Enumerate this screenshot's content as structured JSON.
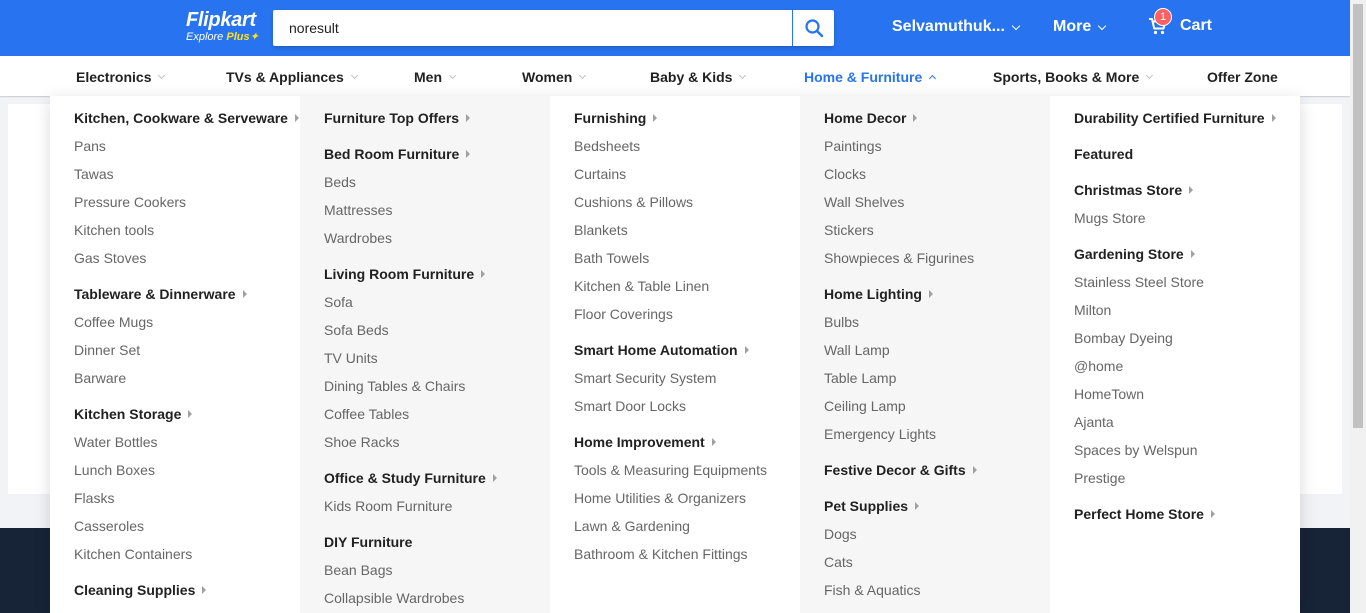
{
  "header": {
    "logo_text": "Flipkart",
    "logo_sub_text": "Explore",
    "logo_plus_text": "Plus",
    "search_value": "noresult",
    "user_name": "Selvamuthuk...",
    "more_label": "More",
    "cart_label": "Cart",
    "cart_count": "1",
    "brand_color": "#2874f0",
    "accent_color": "#ffe11b"
  },
  "categories": [
    {
      "label": "Electronics",
      "active": false
    },
    {
      "label": "TVs & Appliances",
      "active": false
    },
    {
      "label": "Men",
      "active": false
    },
    {
      "label": "Women",
      "active": false
    },
    {
      "label": "Baby & Kids",
      "active": false
    },
    {
      "label": "Home & Furniture",
      "active": true
    },
    {
      "label": "Sports, Books & More",
      "active": false
    },
    {
      "label": "Offer Zone",
      "active": false
    }
  ],
  "menu": {
    "columns": [
      {
        "items": [
          {
            "label": "Kitchen, Cookware & Serveware",
            "type": "head",
            "has_arrow": true
          },
          {
            "label": "Pans",
            "type": "sub"
          },
          {
            "label": "Tawas",
            "type": "sub"
          },
          {
            "label": "Pressure Cookers",
            "type": "sub"
          },
          {
            "label": "Kitchen tools",
            "type": "sub"
          },
          {
            "label": "Gas Stoves",
            "type": "sub"
          },
          {
            "label": "Tableware & Dinnerware",
            "type": "head",
            "has_arrow": true
          },
          {
            "label": "Coffee Mugs",
            "type": "sub"
          },
          {
            "label": "Dinner Set",
            "type": "sub"
          },
          {
            "label": "Barware",
            "type": "sub"
          },
          {
            "label": "Kitchen Storage",
            "type": "head",
            "has_arrow": true
          },
          {
            "label": "Water Bottles",
            "type": "sub"
          },
          {
            "label": "Lunch Boxes",
            "type": "sub"
          },
          {
            "label": "Flasks",
            "type": "sub"
          },
          {
            "label": "Casseroles",
            "type": "sub"
          },
          {
            "label": "Kitchen Containers",
            "type": "sub"
          },
          {
            "label": "Cleaning Supplies",
            "type": "head",
            "has_arrow": true
          }
        ]
      },
      {
        "items": [
          {
            "label": "Furniture Top Offers",
            "type": "head",
            "has_arrow": true
          },
          {
            "label": "Bed Room Furniture",
            "type": "head",
            "has_arrow": true
          },
          {
            "label": "Beds",
            "type": "sub"
          },
          {
            "label": "Mattresses",
            "type": "sub"
          },
          {
            "label": "Wardrobes",
            "type": "sub"
          },
          {
            "label": "Living Room Furniture",
            "type": "head",
            "has_arrow": true
          },
          {
            "label": "Sofa",
            "type": "sub"
          },
          {
            "label": "Sofa Beds",
            "type": "sub"
          },
          {
            "label": "TV Units",
            "type": "sub"
          },
          {
            "label": "Dining Tables & Chairs",
            "type": "sub"
          },
          {
            "label": "Coffee Tables",
            "type": "sub"
          },
          {
            "label": "Shoe Racks",
            "type": "sub"
          },
          {
            "label": "Office & Study Furniture",
            "type": "head",
            "has_arrow": true
          },
          {
            "label": "Kids Room Furniture",
            "type": "sub"
          },
          {
            "label": "DIY Furniture",
            "type": "head",
            "has_arrow": false
          },
          {
            "label": "Bean Bags",
            "type": "sub"
          },
          {
            "label": "Collapsible Wardrobes",
            "type": "sub"
          }
        ]
      },
      {
        "items": [
          {
            "label": "Furnishing",
            "type": "head",
            "has_arrow": true
          },
          {
            "label": "Bedsheets",
            "type": "sub"
          },
          {
            "label": "Curtains",
            "type": "sub"
          },
          {
            "label": "Cushions & Pillows",
            "type": "sub"
          },
          {
            "label": "Blankets",
            "type": "sub"
          },
          {
            "label": "Bath Towels",
            "type": "sub"
          },
          {
            "label": "Kitchen & Table Linen",
            "type": "sub"
          },
          {
            "label": "Floor Coverings",
            "type": "sub"
          },
          {
            "label": "Smart Home Automation",
            "type": "head",
            "has_arrow": true
          },
          {
            "label": "Smart Security System",
            "type": "sub"
          },
          {
            "label": "Smart Door Locks",
            "type": "sub"
          },
          {
            "label": "Home Improvement",
            "type": "head",
            "has_arrow": true
          },
          {
            "label": "Tools & Measuring Equipments",
            "type": "sub"
          },
          {
            "label": "Home Utilities & Organizers",
            "type": "sub"
          },
          {
            "label": "Lawn & Gardening",
            "type": "sub"
          },
          {
            "label": "Bathroom & Kitchen Fittings",
            "type": "sub"
          }
        ]
      },
      {
        "items": [
          {
            "label": "Home Decor",
            "type": "head",
            "has_arrow": true
          },
          {
            "label": "Paintings",
            "type": "sub"
          },
          {
            "label": "Clocks",
            "type": "sub"
          },
          {
            "label": "Wall Shelves",
            "type": "sub"
          },
          {
            "label": "Stickers",
            "type": "sub"
          },
          {
            "label": "Showpieces & Figurines",
            "type": "sub"
          },
          {
            "label": "Home Lighting",
            "type": "head",
            "has_arrow": true
          },
          {
            "label": "Bulbs",
            "type": "sub"
          },
          {
            "label": "Wall Lamp",
            "type": "sub"
          },
          {
            "label": "Table Lamp",
            "type": "sub"
          },
          {
            "label": "Ceiling Lamp",
            "type": "sub"
          },
          {
            "label": "Emergency Lights",
            "type": "sub"
          },
          {
            "label": "Festive Decor & Gifts",
            "type": "head",
            "has_arrow": true
          },
          {
            "label": "Pet Supplies",
            "type": "head",
            "has_arrow": true
          },
          {
            "label": "Dogs",
            "type": "sub"
          },
          {
            "label": "Cats",
            "type": "sub"
          },
          {
            "label": "Fish & Aquatics",
            "type": "sub"
          }
        ]
      },
      {
        "items": [
          {
            "label": "Durability Certified Furniture",
            "type": "head",
            "has_arrow": true
          },
          {
            "label": "Featured",
            "type": "head",
            "has_arrow": false
          },
          {
            "label": "Christmas Store",
            "type": "head",
            "has_arrow": true
          },
          {
            "label": "Mugs Store",
            "type": "sub"
          },
          {
            "label": "Gardening Store",
            "type": "head",
            "has_arrow": true
          },
          {
            "label": "Stainless Steel Store",
            "type": "sub"
          },
          {
            "label": "Milton",
            "type": "sub"
          },
          {
            "label": "Bombay Dyeing",
            "type": "sub"
          },
          {
            "label": "@home",
            "type": "sub"
          },
          {
            "label": "HomeTown",
            "type": "sub"
          },
          {
            "label": "Ajanta",
            "type": "sub"
          },
          {
            "label": "Spaces by Welspun",
            "type": "sub"
          },
          {
            "label": "Prestige",
            "type": "sub"
          },
          {
            "label": "Perfect Home Store",
            "type": "head",
            "has_arrow": true
          }
        ]
      }
    ]
  }
}
